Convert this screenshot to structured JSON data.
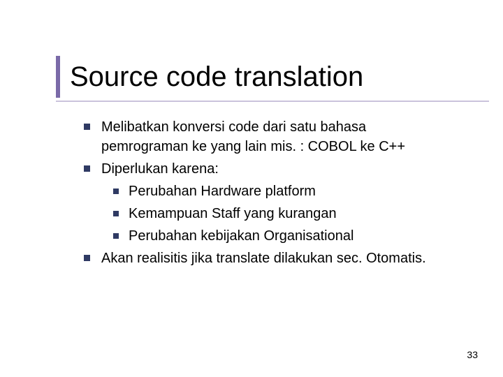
{
  "slide": {
    "title": "Source code translation",
    "bullets": [
      {
        "text": "Melibatkan konversi code dari satu bahasa pemrograman ke yang lain mis. : COBOL ke C++"
      },
      {
        "text": "Diperlukan karena:",
        "children": [
          {
            "text": "Perubahan Hardware platform"
          },
          {
            "text": "Kemampuan Staff yang kurangan"
          },
          {
            "text": "Perubahan kebijakan Organisational"
          }
        ]
      },
      {
        "text": "Akan realisitis jika translate dilakukan sec. Otomatis."
      }
    ],
    "page_number": "33"
  }
}
